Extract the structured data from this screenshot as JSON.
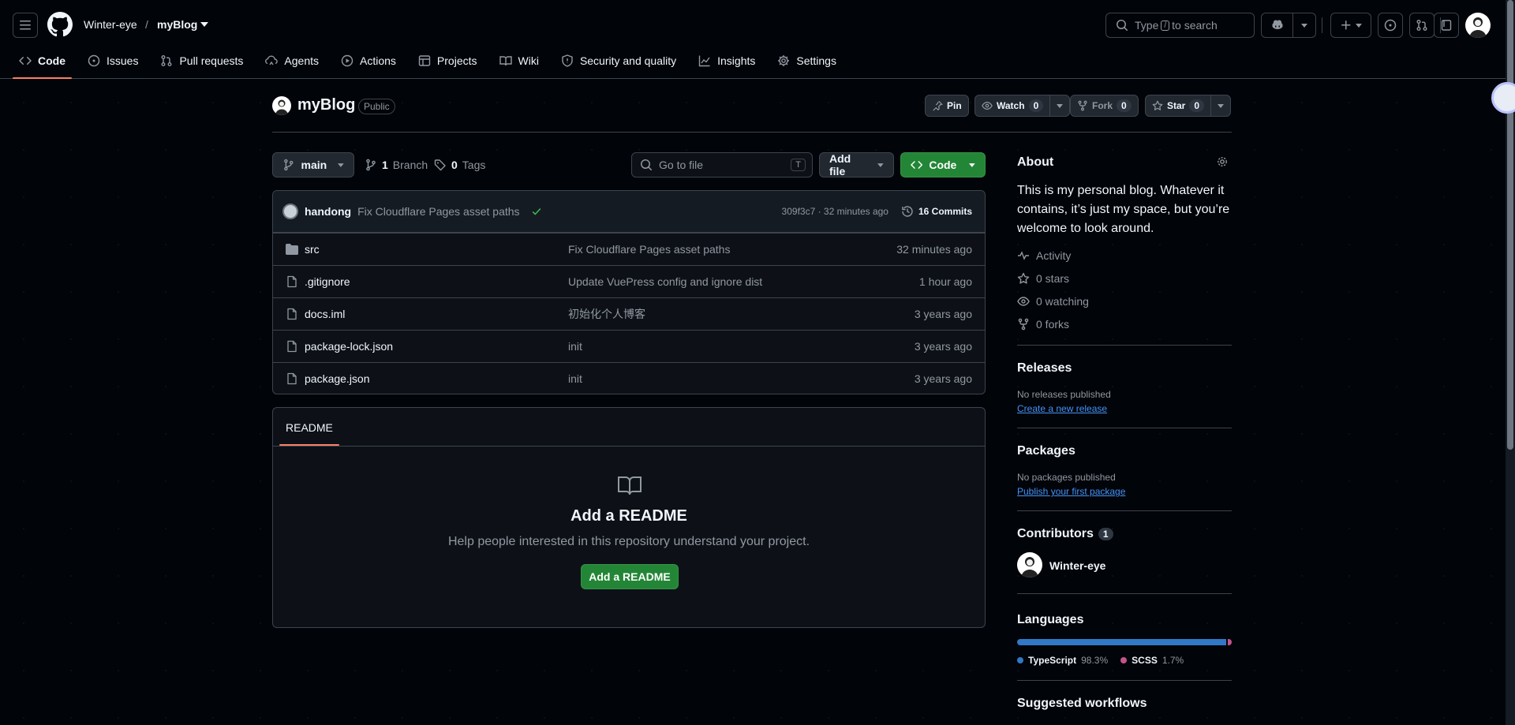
{
  "header": {
    "owner": "Winter-eye",
    "separator": "/",
    "repo": "myBlog",
    "search_prefix": "Type",
    "search_key": "/",
    "search_suffix": "to search"
  },
  "tabs": [
    {
      "label": "Code",
      "icon": "code-icon"
    },
    {
      "label": "Issues",
      "icon": "issue-icon"
    },
    {
      "label": "Pull requests",
      "icon": "pull-request-icon"
    },
    {
      "label": "Agents",
      "icon": "agents-icon"
    },
    {
      "label": "Actions",
      "icon": "play-icon"
    },
    {
      "label": "Projects",
      "icon": "table-icon"
    },
    {
      "label": "Wiki",
      "icon": "book-icon"
    },
    {
      "label": "Security and quality",
      "icon": "shield-icon"
    },
    {
      "label": "Insights",
      "icon": "graph-icon"
    },
    {
      "label": "Settings",
      "icon": "gear-icon"
    }
  ],
  "repo_header": {
    "name": "myBlog",
    "visibility": "Public",
    "pin_label": "Pin",
    "watch_label": "Watch",
    "watch_count": "0",
    "fork_label": "Fork",
    "fork_count": "0",
    "star_label": "Star",
    "star_count": "0"
  },
  "file_nav": {
    "branch": "main",
    "branch_count": "1",
    "branch_label": "Branch",
    "tag_count": "0",
    "tag_label": "Tags",
    "goto_placeholder": "Go to file",
    "goto_key": "T",
    "add_file_label": "Add file",
    "code_label": "Code"
  },
  "latest_commit": {
    "author": "handong",
    "message": "Fix Cloudflare Pages asset paths",
    "meta": "309f3c7 · 32 minutes ago",
    "commits_label": "16 Commits"
  },
  "files": [
    {
      "name": "src",
      "type": "folder",
      "message": "Fix Cloudflare Pages asset paths",
      "date": "32 minutes ago"
    },
    {
      "name": ".gitignore",
      "type": "file",
      "message": "Update VuePress config and ignore dist",
      "date": "1 hour ago"
    },
    {
      "name": "docs.iml",
      "type": "file",
      "message": "初始化个人博客",
      "date": "3 years ago"
    },
    {
      "name": "package-lock.json",
      "type": "file",
      "message": "init",
      "date": "3 years ago"
    },
    {
      "name": "package.json",
      "type": "file",
      "message": "init",
      "date": "3 years ago"
    }
  ],
  "readme": {
    "tab": "README",
    "title": "Add a README",
    "text": "Help people interested in this repository understand your project.",
    "button": "Add a README"
  },
  "sidebar": {
    "about_title": "About",
    "about_text": "This is my personal blog. Whatever it contains, it’s just my space, but you’re welcome to look around.",
    "activity": "Activity",
    "stars": "0 stars",
    "watching": "0 watching",
    "forks": "0 forks",
    "releases_title": "Releases",
    "releases_text": "No releases published",
    "releases_link": "Create a new release",
    "packages_title": "Packages",
    "packages_text": "No packages published",
    "packages_link": "Publish your first package",
    "contributors_title": "Contributors",
    "contributors_count": "1",
    "contributor_name": "Winter-eye",
    "languages_title": "Languages",
    "languages": [
      {
        "name": "TypeScript",
        "percent": "98.3%",
        "value": 98.3,
        "color": "#3178c6"
      },
      {
        "name": "SCSS",
        "percent": "1.7%",
        "value": 1.7,
        "color": "#c6538c"
      }
    ],
    "suggested_title": "Suggested workflows"
  },
  "colors": {
    "accent_green": "#238636",
    "tab_underline": "#f78166",
    "link_blue": "#4493f8"
  }
}
